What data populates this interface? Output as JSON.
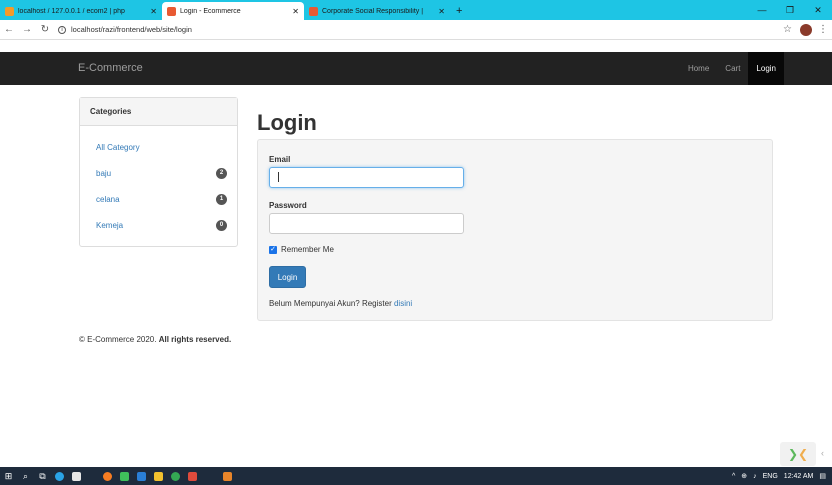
{
  "browser": {
    "tabs": [
      {
        "label": "localhost / 127.0.0.1 / ecom2 | php",
        "close": "✕"
      },
      {
        "label": "Login - Ecommerce",
        "close": "✕"
      },
      {
        "label": "Corporate Social Responsibility |",
        "close": "✕"
      }
    ],
    "new_tab": "+",
    "url": "localhost/razi/frontend/web/site/login"
  },
  "navbar": {
    "brand": "E-Commerce",
    "links": [
      "Home",
      "Cart",
      "Login"
    ]
  },
  "sidebar": {
    "title": "Categories",
    "items": [
      {
        "label": "All Category",
        "count": ""
      },
      {
        "label": "baju",
        "count": "2"
      },
      {
        "label": "celana",
        "count": "1"
      },
      {
        "label": "Kemeja",
        "count": "0"
      }
    ]
  },
  "login": {
    "title": "Login",
    "email_label": "Email",
    "email_value": "",
    "password_label": "Password",
    "password_value": "",
    "remember_label": "Remember Me",
    "remember_checked": true,
    "button": "Login",
    "register_text": "Belum Mempunyai Akun? Register",
    "register_link": "disini"
  },
  "footer": {
    "copyright": "© E-Commerce 2020.",
    "rights": "All rights reserved."
  },
  "taskbar": {
    "tray_lang": "ENG",
    "time": "12:42 AM"
  },
  "colors": {
    "tabbar": "#1ec5e4",
    "navbar": "#222222",
    "link": "#337ab7",
    "button": "#337ab7"
  }
}
